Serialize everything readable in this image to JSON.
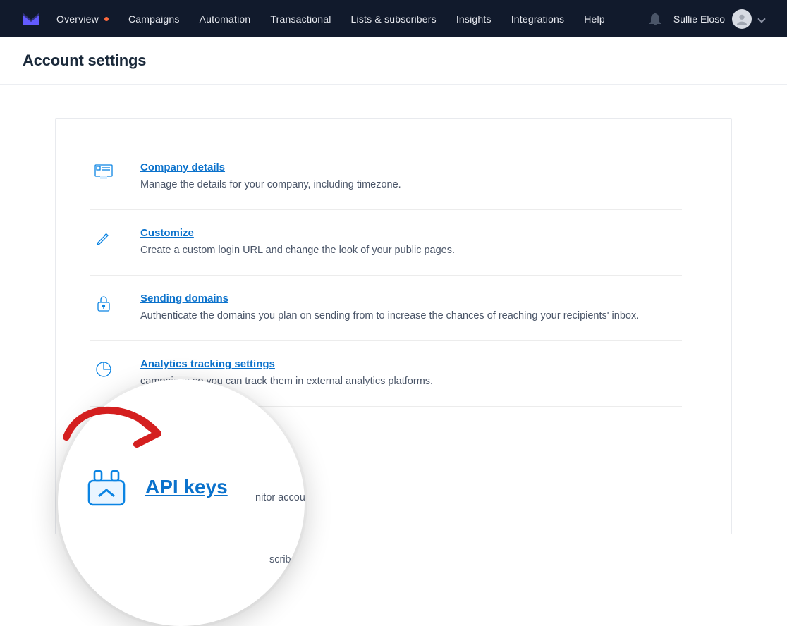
{
  "nav": {
    "items": [
      {
        "label": "Overview",
        "dot": true
      },
      {
        "label": "Campaigns"
      },
      {
        "label": "Automation"
      },
      {
        "label": "Transactional"
      },
      {
        "label": "Lists & subscribers"
      },
      {
        "label": "Insights"
      },
      {
        "label": "Integrations"
      },
      {
        "label": "Help"
      }
    ],
    "user": "Sullie Eloso"
  },
  "header": {
    "title": "Account settings"
  },
  "settings": [
    {
      "icon": "company",
      "title": "Company details",
      "desc": "Manage the details for your company, including timezone."
    },
    {
      "icon": "pencil",
      "title": "Customize",
      "desc": "Create a custom login URL and change the look of your public pages."
    },
    {
      "icon": "lock",
      "title": "Sending domains",
      "desc": "Authenticate the domains you plan on sending from to increase the chances of reaching your recipients' inbox."
    },
    {
      "icon": "pie",
      "title": "Analytics tracking settings",
      "desc": "campaigns so you can track them in external analytics platforms."
    }
  ],
  "zoom": {
    "title": "API keys",
    "sub1": "nitor account via our fully-featured API.",
    "sub2": "scribe from your emails."
  }
}
